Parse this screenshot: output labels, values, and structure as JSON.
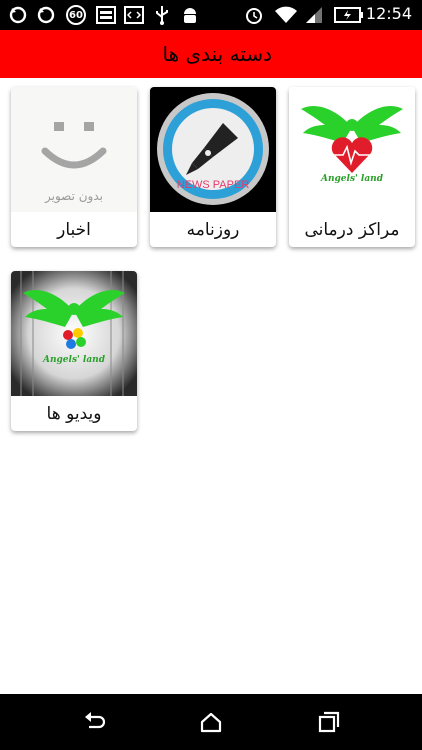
{
  "status_bar": {
    "time": "12:54",
    "icons": [
      "sync-icon",
      "sync-icon",
      "sixty-badge-icon",
      "image-icon",
      "code-icon",
      "usb-icon",
      "android-icon",
      "alarm-icon",
      "wifi-icon",
      "signal-icon",
      "battery-icon"
    ],
    "badge_text": "60"
  },
  "app_bar": {
    "title": "دسته بندی ها",
    "color": "#ff0000"
  },
  "categories": [
    {
      "label": "مراکز درمانی",
      "thumb": "angels-land-logo",
      "logo_text": "Angels' land"
    },
    {
      "label": "روزنامه",
      "thumb": "news-paper-pen",
      "logo_text": "NEWS PAPER"
    },
    {
      "label": "اخبار",
      "thumb": "no-image-placeholder",
      "logo_text": "بدون تصویر"
    },
    {
      "label": "ویدیو ها",
      "thumb": "angels-land-logo-curtain",
      "logo_text": "Angels' land"
    }
  ],
  "nav_bar": {
    "buttons": [
      "back-icon",
      "home-icon",
      "recents-icon"
    ]
  }
}
